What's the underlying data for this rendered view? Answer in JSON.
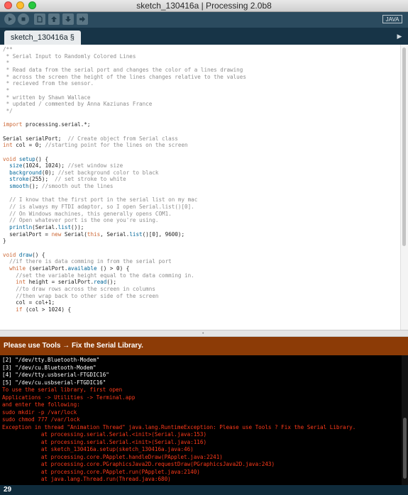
{
  "window": {
    "title": "sketch_130416a | Processing 2.0b8"
  },
  "toolbar": {
    "buttons": [
      {
        "name": "run",
        "icon": "play-icon"
      },
      {
        "name": "stop",
        "icon": "stop-icon"
      },
      {
        "name": "new",
        "icon": "new-file-icon"
      },
      {
        "name": "open",
        "icon": "open-icon"
      },
      {
        "name": "save",
        "icon": "save-icon"
      },
      {
        "name": "export",
        "icon": "export-icon"
      }
    ],
    "mode": "JAVA"
  },
  "tabs": [
    {
      "label": "sketch_130416a §"
    }
  ],
  "editor": {
    "lines": [
      "/**",
      " * Serial Input to Randomly Colored Lines",
      " *",
      " * Read data from the serial port and changes the color of a lines drawing",
      " * across the screen the height of the lines changes relative to the values",
      " * recieved from the sensor.",
      " *",
      " * written by Shawn Wallace",
      " * updated / commented by Anna Kaziunas France",
      " */",
      "",
      "import processing.serial.*;",
      "",
      "Serial serialPort;  // Create object from Serial class",
      "int col = 0; //starting point for the lines on the screen",
      "",
      "void setup() {",
      "  size(1024, 1024); //set window size",
      "  background(0); //set background color to black",
      "  stroke(255);  // set stroke to white",
      "  smooth(); //smooth out the lines",
      "",
      "  // I know that the first port in the serial list on my mac",
      "  // is always my FTDI adaptor, so I open Serial.list()[0].",
      "  // On Windows machines, this generally opens COM1.",
      "  // Open whatever port is the one you're using.",
      "  println(Serial.list());",
      "  serialPort = new Serial(this, Serial.list()[0], 9600);",
      "}",
      "",
      "void draw() {",
      "  //if there is data comming in from the serial port",
      "  while (serialPort.available () > 0) {",
      "    //set the variable height equal to the data comming in.",
      "    int height = serialPort.read();",
      "    //to draw rows across the screen in columns",
      "    //then wrap back to other side of the screen",
      "    col = col+1;",
      "    if (col > 1024) {"
    ]
  },
  "message": "Please use Tools → Fix the Serial Library.",
  "console": {
    "lines": [
      {
        "text": "[2] \"/dev/tty.Bluetooth-Modem\"",
        "type": "out"
      },
      {
        "text": "[3] \"/dev/cu.Bluetooth-Modem\"",
        "type": "out"
      },
      {
        "text": "[4] \"/dev/tty.usbserial-FTGDIC16\"",
        "type": "out"
      },
      {
        "text": "[5] \"/dev/cu.usbserial-FTGDIC16\"",
        "type": "out"
      },
      {
        "text": "To use the serial library, first open",
        "type": "err"
      },
      {
        "text": "Applications -> Utilities -> Terminal.app",
        "type": "err"
      },
      {
        "text": "and enter the following:",
        "type": "err"
      },
      {
        "text": "sudo mkdir -p /var/lock",
        "type": "err"
      },
      {
        "text": "sudo chmod 777 /var/lock",
        "type": "err"
      },
      {
        "text": "Exception in thread \"Animation Thread\" java.lang.RuntimeException: Please use Tools ? Fix the Serial Library.",
        "type": "err"
      },
      {
        "text": "            at processing.serial.Serial.<init>(Serial.java:153)",
        "type": "err"
      },
      {
        "text": "            at processing.serial.Serial.<init>(Serial.java:116)",
        "type": "err"
      },
      {
        "text": "            at sketch_130416a.setup(sketch_130416a.java:46)",
        "type": "err"
      },
      {
        "text": "            at processing.core.PApplet.handleDraw(PApplet.java:2241)",
        "type": "err"
      },
      {
        "text": "            at processing.core.PGraphicsJava2D.requestDraw(PGraphicsJava2D.java:243)",
        "type": "err"
      },
      {
        "text": "            at processing.core.PApplet.run(PApplet.java:2140)",
        "type": "err"
      },
      {
        "text": "            at java.lang.Thread.run(Thread.java:680)",
        "type": "err"
      }
    ]
  },
  "status": {
    "line_number": "29"
  },
  "colors": {
    "toolbar": "#2b4b5f",
    "tabbar": "#173447",
    "message_bar": "#8c3b06",
    "console_bg": "#000000",
    "console_error": "#ff3a1a",
    "keyword": "#cc6633",
    "function": "#006699",
    "comment": "#8e8e8e"
  }
}
